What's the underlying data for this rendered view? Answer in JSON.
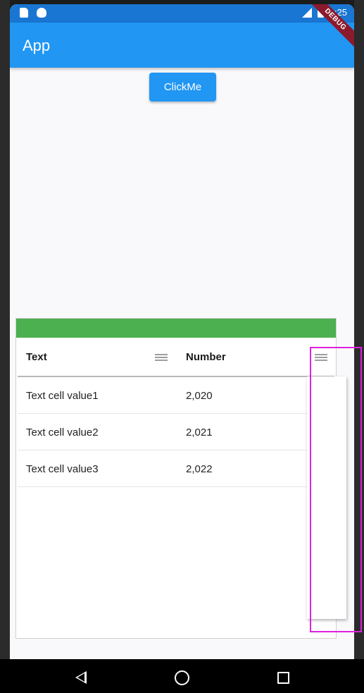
{
  "status_bar": {
    "time": "1:25"
  },
  "app_bar": {
    "title": "App"
  },
  "debug_banner": {
    "label": "DEBUG"
  },
  "actions": {
    "click_me_label": "ClickMe"
  },
  "grid": {
    "toolbar_color": "#4caf50",
    "columns": [
      {
        "title": "Text"
      },
      {
        "title": "Number"
      }
    ],
    "rows": [
      {
        "text": "Text cell value1",
        "number": "2,020"
      },
      {
        "text": "Text cell value2",
        "number": "2,021"
      },
      {
        "text": "Text cell value3",
        "number": "2,022"
      }
    ]
  },
  "icons": {
    "status_left": [
      "sd-card-icon",
      "android-debug-icon"
    ],
    "status_right": [
      "signal-icon",
      "battery-icon"
    ],
    "column_menu": "menu-icon",
    "navigation": [
      "back-icon",
      "home-icon",
      "recent-apps-icon"
    ]
  },
  "colors": {
    "app_bar": "#2196f3",
    "status_bar": "#1976d2",
    "button": "#2196f3",
    "highlight": "#e020e0"
  }
}
